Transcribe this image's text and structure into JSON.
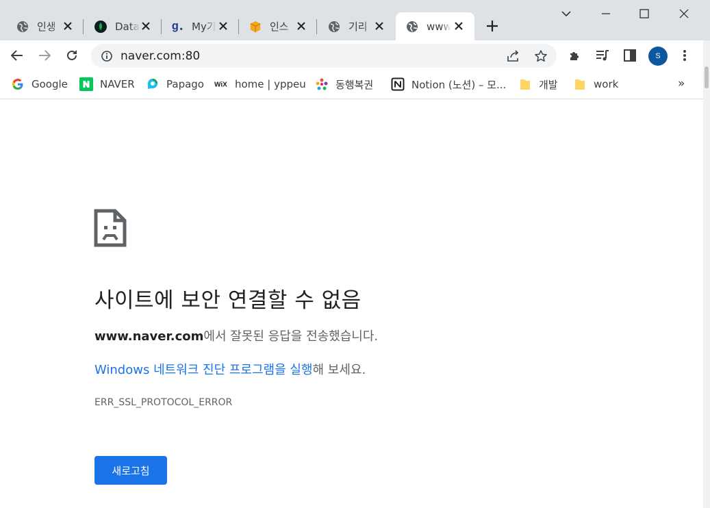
{
  "tabs": [
    {
      "title": "인생",
      "icon": "globe-icon"
    },
    {
      "title": "Data",
      "icon": "mongodb-leaf-icon"
    },
    {
      "title": "My기",
      "icon": "g-logo-icon"
    },
    {
      "title": "인스",
      "icon": "box-icon"
    },
    {
      "title": "기리",
      "icon": "globe-icon"
    },
    {
      "title": "www",
      "icon": "globe-icon",
      "active": true
    }
  ],
  "toolbar": {
    "url": "naver.com:80",
    "avatar_letter": "S"
  },
  "bookmarks": [
    {
      "label": "Google",
      "icon": "google-icon"
    },
    {
      "label": "NAVER",
      "icon": "naver-icon"
    },
    {
      "label": "Papago",
      "icon": "papago-icon"
    },
    {
      "label": "home | yppeu",
      "icon": "wix-icon"
    },
    {
      "label": "동행복권",
      "icon": "lottery-icon"
    },
    {
      "label": "Notion (노션) – 모...",
      "icon": "notion-icon"
    },
    {
      "label": "개발",
      "icon": "folder-icon"
    },
    {
      "label": "work",
      "icon": "folder-icon"
    }
  ],
  "bookmarks_overflow": "»",
  "error_page": {
    "heading": "사이트에 보안 연결할 수 없음",
    "host": "www.naver.com",
    "message_suffix": "에서 잘못된 응답을 전송했습니다.",
    "diagnostics_link": "Windows 네트워크 진단 프로그램을 실행",
    "diagnostics_suffix": "해 보세요.",
    "error_code": "ERR_SSL_PROTOCOL_ERROR",
    "reload_label": "새로고침"
  },
  "colors": {
    "accent": "#1a73e8",
    "tabstrip": "#dee1e6",
    "avatar": "#0b57a0"
  }
}
